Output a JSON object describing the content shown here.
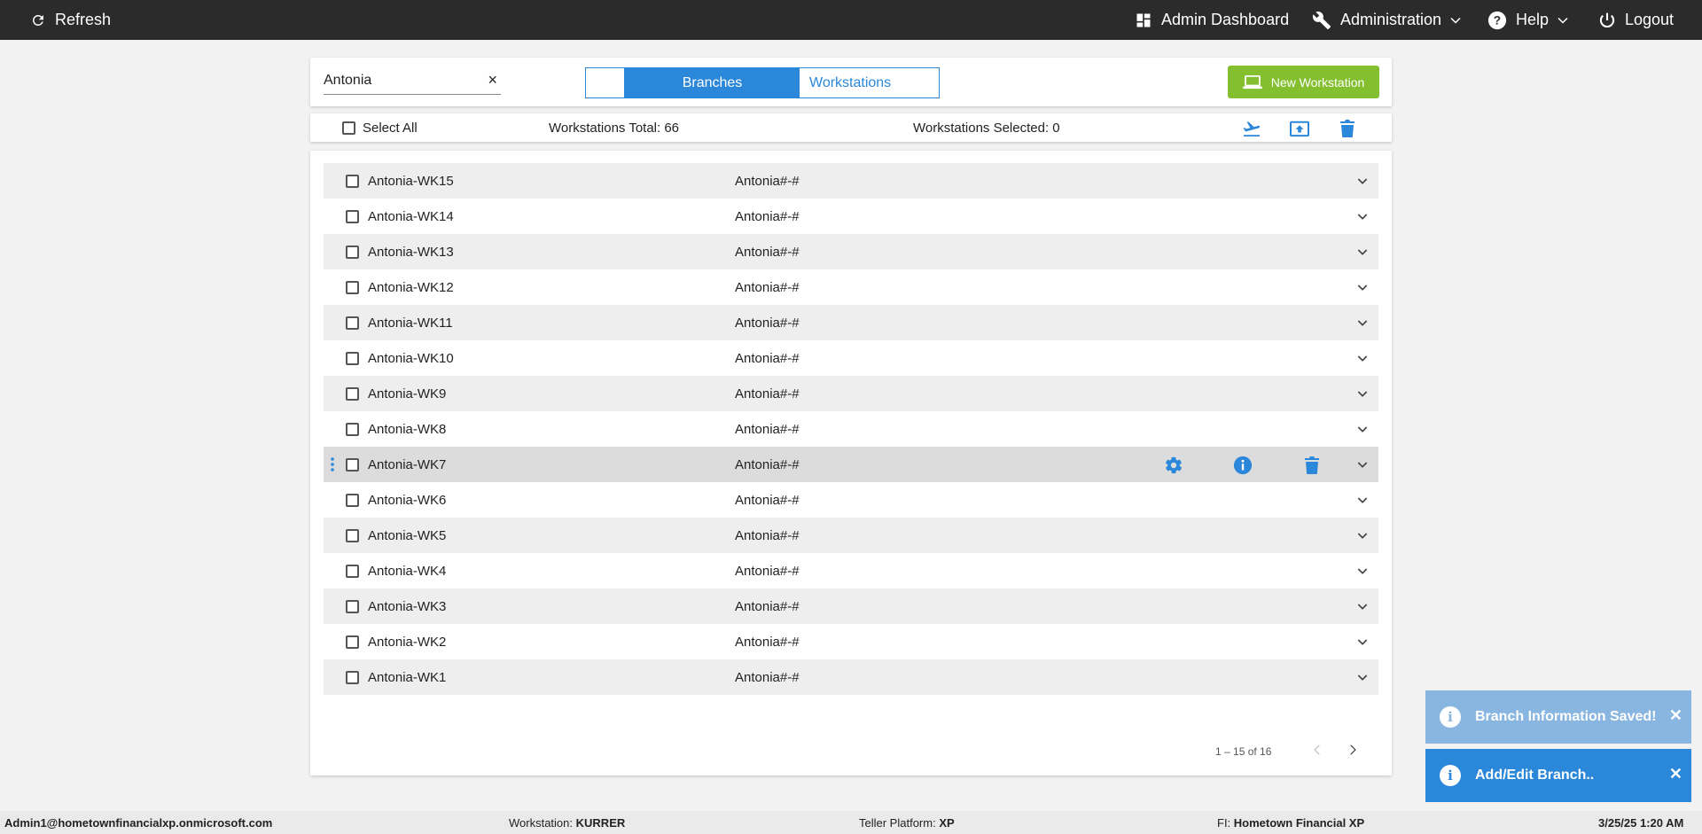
{
  "topbar": {
    "refresh_label": "Refresh",
    "admin_dashboard_label": "Admin Dashboard",
    "administration_label": "Administration",
    "help_label": "Help",
    "logout_label": "Logout"
  },
  "search": {
    "value": "Antonia",
    "clear_glyph": "×"
  },
  "view_toggle": {
    "active_label": "Branches",
    "inactive_label": "Workstations"
  },
  "new_workstation_label": "New Workstation",
  "summary": {
    "select_all_label": "Select All",
    "total_label": "Workstations Total: 66",
    "selected_label": "Workstations Selected: 0"
  },
  "rows": [
    {
      "name": "Antonia-WK15",
      "branch": "Antonia#-#"
    },
    {
      "name": "Antonia-WK14",
      "branch": "Antonia#-#"
    },
    {
      "name": "Antonia-WK13",
      "branch": "Antonia#-#"
    },
    {
      "name": "Antonia-WK12",
      "branch": "Antonia#-#"
    },
    {
      "name": "Antonia-WK11",
      "branch": "Antonia#-#"
    },
    {
      "name": "Antonia-WK10",
      "branch": "Antonia#-#"
    },
    {
      "name": "Antonia-WK9",
      "branch": "Antonia#-#"
    },
    {
      "name": "Antonia-WK8",
      "branch": "Antonia#-#"
    },
    {
      "name": "Antonia-WK7",
      "branch": "Antonia#-#"
    },
    {
      "name": "Antonia-WK6",
      "branch": "Antonia#-#"
    },
    {
      "name": "Antonia-WK5",
      "branch": "Antonia#-#"
    },
    {
      "name": "Antonia-WK4",
      "branch": "Antonia#-#"
    },
    {
      "name": "Antonia-WK3",
      "branch": "Antonia#-#"
    },
    {
      "name": "Antonia-WK2",
      "branch": "Antonia#-#"
    },
    {
      "name": "Antonia-WK1",
      "branch": "Antonia#-#"
    }
  ],
  "pagination": {
    "range_label": "1 – 15 of 16"
  },
  "footer": {
    "user": "Admin1@hometownfinancialxp.onmicrosoft.com",
    "workstation_label": "Workstation:",
    "workstation_value": "KURRER",
    "platform_label": "Teller Platform:",
    "platform_value": "XP",
    "fi_label": "FI:",
    "fi_value": "Hometown Financial XP",
    "datetime": "3/25/25 1:20 AM"
  },
  "toasts": [
    {
      "message": "Branch Information Saved!",
      "color": "#88b6e0"
    },
    {
      "message": "Add/Edit Branch..",
      "color": "#2b87d9"
    }
  ],
  "colors": {
    "accent": "#2b87d9",
    "new_button": "#83bf2f",
    "topbar": "#2b2b2b"
  }
}
